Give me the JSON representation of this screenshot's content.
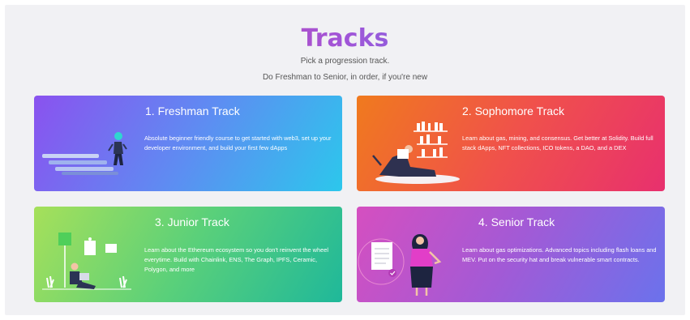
{
  "header": {
    "title": "Tracks",
    "subtitle_line1": "Pick a progression track.",
    "subtitle_line2": "Do Freshman to Senior, in order, if you're new"
  },
  "cards": [
    {
      "title": "1. Freshman Track",
      "description": "Absolute beginner friendly course to get started with web3, set up your developer environment, and build your first few dApps",
      "illustration": "person-climbing-stairs-illustration"
    },
    {
      "title": "2. Sophomore Track",
      "description": "Learn about gas, mining, and consensus. Get better at Solidity. Build full stack dApps, NFT collections, ICO tokens, a DAO, and a DEX",
      "illustration": "person-reading-by-bookshelf-illustration"
    },
    {
      "title": "3. Junior Track",
      "description": "Learn about the Ethereum ecosystem so you don't reinvent the wheel everytime. Build with Chainlink, ENS, The Graph, IPFS, Ceramic, Polygon, and more",
      "illustration": "person-sitting-with-laptop-illustration"
    },
    {
      "title": "4. Senior Track",
      "description": "Learn about gas optimizations. Advanced topics including flash loans and MEV. Put on the security hat and break vulnerable smart contracts.",
      "illustration": "woman-with-checklist-illustration"
    }
  ],
  "colors": {
    "title_gradient": [
      "#e83e8c",
      "#a155d8",
      "#3d8cf0"
    ],
    "freshman": [
      "#8a52ef",
      "#2cc7ec"
    ],
    "sophomore": [
      "#f07a1e",
      "#e8306e"
    ],
    "junior": [
      "#a6e05a",
      "#1fb89a"
    ],
    "senior": [
      "#d54fc0",
      "#6b72ec"
    ]
  }
}
